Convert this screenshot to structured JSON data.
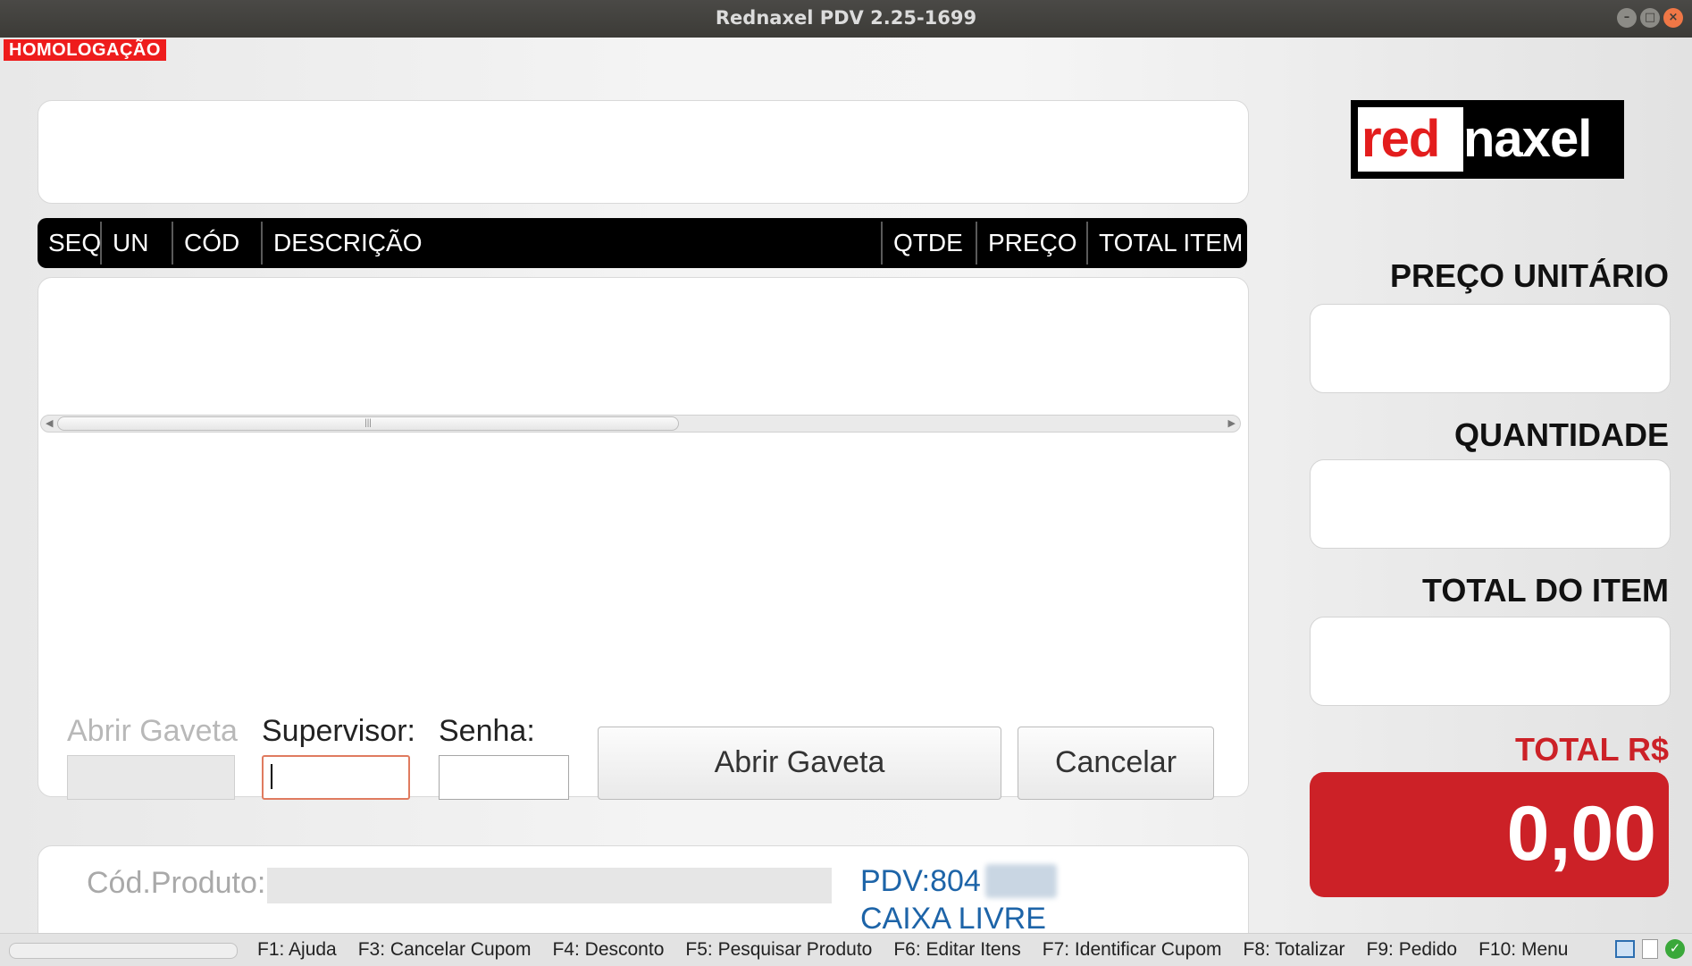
{
  "window": {
    "title": "Rednaxel PDV 2.25-1699",
    "controls": [
      "–",
      "□",
      "×"
    ]
  },
  "badge": {
    "homologacao": "HOMOLOGAÇÃO"
  },
  "table": {
    "columns": [
      "SEQ",
      "UN",
      "CÓD",
      "DESCRIÇÃO",
      "QTDE",
      "PREÇO",
      "TOTAL ITEM"
    ],
    "rows": [],
    "scroll_grip": "|||"
  },
  "drawer_form": {
    "title_disabled": "Abrir Gaveta",
    "supervisor_label": "Supervisor:",
    "senha_label": "Senha:",
    "supervisor_value": "",
    "senha_value": "",
    "open_button": "Abrir Gaveta",
    "cancel_button": "Cancelar"
  },
  "product": {
    "cod_label": "Cód.Produto:",
    "cod_value": "",
    "pdv": "PDV:804",
    "status": "CAIXA LIVRE"
  },
  "logo": {
    "part1": "red",
    "part2": "naxel"
  },
  "side": {
    "preco_label": "PREÇO UNITÁRIO",
    "preco_value": "",
    "qtd_label": "QUANTIDADE",
    "qtd_value": "",
    "total_item_label": "TOTAL DO ITEM",
    "total_item_value": "",
    "total_label": "TOTAL R$",
    "total_value": "0,00"
  },
  "statusbar": {
    "fkeys": [
      "F1: Ajuda",
      "F3: Cancelar Cupom",
      "F4: Desconto",
      "F5: Pesquisar Produto",
      "F6: Editar Itens",
      "F7: Identificar Cupom",
      "F8: Totalizar",
      "F9: Pedido",
      "F10: Menu"
    ]
  },
  "colors": {
    "accent_red": "#cc2127",
    "badge_red": "#ee1c1c",
    "pdv_blue": "#1d64a8"
  },
  "icons": [
    "window-icon",
    "document-icon",
    "check-ok-icon"
  ]
}
